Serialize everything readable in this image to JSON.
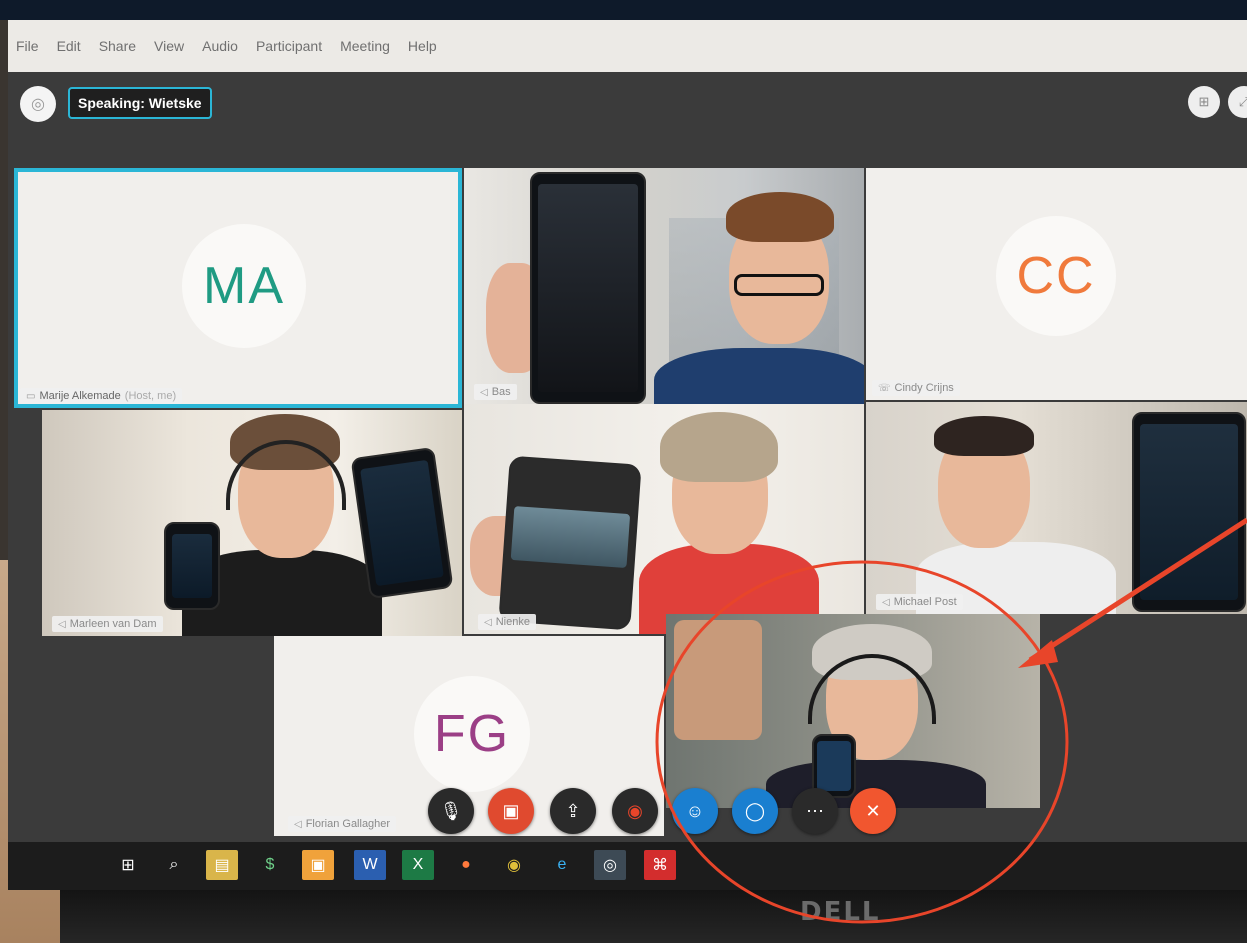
{
  "menubar": {
    "items": [
      "File",
      "Edit",
      "Share",
      "View",
      "Audio",
      "Participant",
      "Meeting",
      "Help"
    ]
  },
  "topbar": {
    "speaking": "Speaking: Wietske"
  },
  "tiles": {
    "ma": {
      "initials": "MA",
      "name": "Marije Alkemade",
      "suffix": "(Host, me)",
      "color": "#1f9b83"
    },
    "bas": {
      "name": "Bas"
    },
    "cc": {
      "initials": "CC",
      "name": "Cindy Crijns",
      "color": "#f07a3c"
    },
    "marleen": {
      "name": "Marleen van Dam"
    },
    "nienke": {
      "name": "Nienke"
    },
    "michael": {
      "name": "Michael Post"
    },
    "fg": {
      "initials": "FG",
      "name": "Florian Gallagher",
      "color": "#9b3f86"
    }
  },
  "controls": [
    {
      "name": "mute-button",
      "icon": "microphone-off-icon"
    },
    {
      "name": "stop-video-button",
      "icon": "video-off-icon"
    },
    {
      "name": "share-button",
      "icon": "share-icon"
    },
    {
      "name": "record-button",
      "icon": "record-icon"
    },
    {
      "name": "participants-button",
      "icon": "person-icon"
    },
    {
      "name": "chat-button",
      "icon": "chat-icon"
    },
    {
      "name": "more-options-button",
      "icon": "ellipsis-icon"
    },
    {
      "name": "leave-meeting-button",
      "icon": "close-icon"
    }
  ],
  "colors": {
    "accent": "#2bb6d6",
    "video_off_red": "#e04a2f",
    "leave_orange": "#f1562f",
    "control_blue": "#1a7fd0",
    "annotation_red": "#e8452a"
  },
  "brand": {
    "laptop": "DELL"
  }
}
